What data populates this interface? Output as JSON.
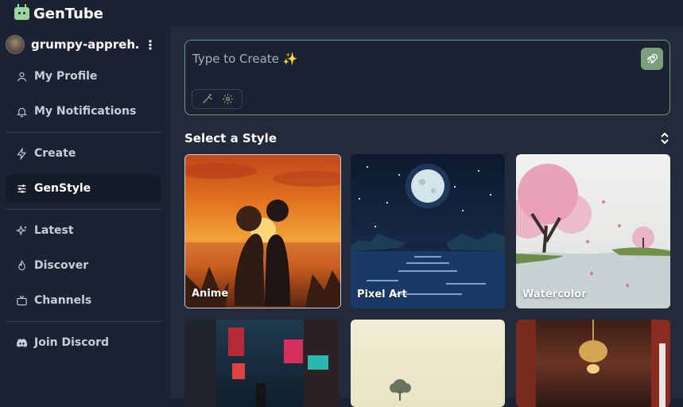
{
  "app": {
    "name": "GenTube"
  },
  "user": {
    "name": "grumpy-appreh…"
  },
  "sidebar": {
    "items": [
      {
        "label": "My Profile"
      },
      {
        "label": "My Notifications"
      },
      {
        "label": "Create"
      },
      {
        "label": "GenStyle"
      },
      {
        "label": "Latest"
      },
      {
        "label": "Discover"
      },
      {
        "label": "Channels"
      },
      {
        "label": "Join Discord"
      }
    ]
  },
  "prompt": {
    "placeholder": "Type to Create ✨"
  },
  "styles": {
    "title": "Select a Style",
    "cards": [
      {
        "label": "Anime"
      },
      {
        "label": "Pixel Art"
      },
      {
        "label": "Watercolor"
      },
      {
        "label": ""
      },
      {
        "label": ""
      },
      {
        "label": ""
      }
    ]
  },
  "icons": {
    "logo": "robot-icon",
    "profile": "user-icon",
    "notifications": "bell-icon",
    "create": "zap-icon",
    "genstyle": "sliders-icon",
    "latest": "sparkles-icon",
    "discover": "flame-icon",
    "channels": "tv-icon",
    "discord": "discord-icon",
    "send": "rocket-icon",
    "magic": "wand-icon",
    "settings": "gear-icon",
    "sort": "chevrons-up-down-icon"
  },
  "colors": {
    "accent": "#7a9f7f",
    "border": "#6c9e74",
    "background": "#1b2231"
  }
}
